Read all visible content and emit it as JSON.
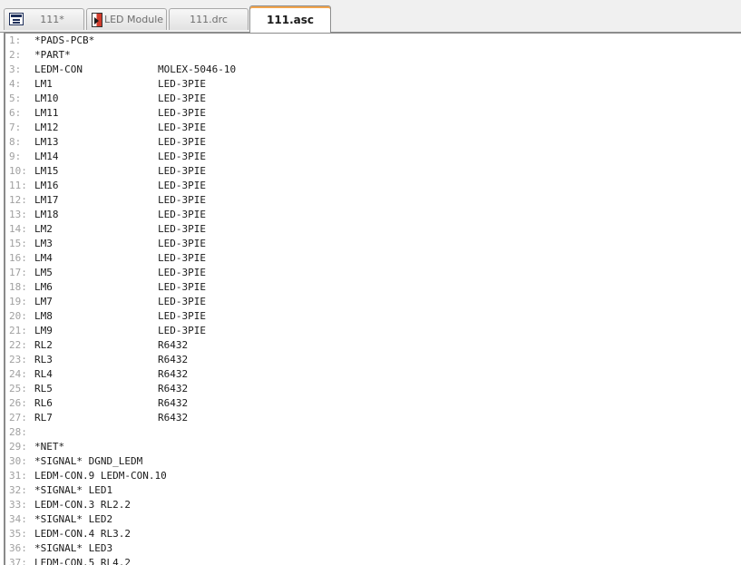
{
  "tabs": [
    {
      "label": "111*",
      "icon": "layout-icon",
      "active": false
    },
    {
      "label": "LED Module",
      "icon": "schematic-icon",
      "active": false
    },
    {
      "label": "111.drc",
      "icon": "",
      "active": false
    },
    {
      "label": "111.asc",
      "icon": "",
      "active": true
    }
  ],
  "lines": [
    {
      "n": "1:",
      "a": "*PADS-PCB*",
      "b": ""
    },
    {
      "n": "2:",
      "a": "*PART*",
      "b": ""
    },
    {
      "n": "3:",
      "a": "LEDM-CON",
      "b": "MOLEX-5046-10"
    },
    {
      "n": "4:",
      "a": "LM1",
      "b": "LED-3PIE"
    },
    {
      "n": "5:",
      "a": "LM10",
      "b": "LED-3PIE"
    },
    {
      "n": "6:",
      "a": "LM11",
      "b": "LED-3PIE"
    },
    {
      "n": "7:",
      "a": "LM12",
      "b": "LED-3PIE"
    },
    {
      "n": "8:",
      "a": "LM13",
      "b": "LED-3PIE"
    },
    {
      "n": "9:",
      "a": "LM14",
      "b": "LED-3PIE"
    },
    {
      "n": "10:",
      "a": "LM15",
      "b": "LED-3PIE"
    },
    {
      "n": "11:",
      "a": "LM16",
      "b": "LED-3PIE"
    },
    {
      "n": "12:",
      "a": "LM17",
      "b": "LED-3PIE"
    },
    {
      "n": "13:",
      "a": "LM18",
      "b": "LED-3PIE"
    },
    {
      "n": "14:",
      "a": "LM2",
      "b": "LED-3PIE"
    },
    {
      "n": "15:",
      "a": "LM3",
      "b": "LED-3PIE"
    },
    {
      "n": "16:",
      "a": "LM4",
      "b": "LED-3PIE"
    },
    {
      "n": "17:",
      "a": "LM5",
      "b": "LED-3PIE"
    },
    {
      "n": "18:",
      "a": "LM6",
      "b": "LED-3PIE"
    },
    {
      "n": "19:",
      "a": "LM7",
      "b": "LED-3PIE"
    },
    {
      "n": "20:",
      "a": "LM8",
      "b": "LED-3PIE"
    },
    {
      "n": "21:",
      "a": "LM9",
      "b": "LED-3PIE"
    },
    {
      "n": "22:",
      "a": "RL2",
      "b": "R6432"
    },
    {
      "n": "23:",
      "a": "RL3",
      "b": "R6432"
    },
    {
      "n": "24:",
      "a": "RL4",
      "b": "R6432"
    },
    {
      "n": "25:",
      "a": "RL5",
      "b": "R6432"
    },
    {
      "n": "26:",
      "a": "RL6",
      "b": "R6432"
    },
    {
      "n": "27:",
      "a": "RL7",
      "b": "R6432"
    },
    {
      "n": "28:",
      "a": "",
      "b": ""
    },
    {
      "n": "29:",
      "a": "*NET*",
      "b": ""
    },
    {
      "n": "30:",
      "a": "*SIGNAL* DGND_LEDM",
      "b": ""
    },
    {
      "n": "31:",
      "a": "LEDM-CON.9 LEDM-CON.10",
      "b": ""
    },
    {
      "n": "32:",
      "a": "*SIGNAL* LED1",
      "b": ""
    },
    {
      "n": "33:",
      "a": "LEDM-CON.3 RL2.2",
      "b": ""
    },
    {
      "n": "34:",
      "a": "*SIGNAL* LED2",
      "b": ""
    },
    {
      "n": "35:",
      "a": "LEDM-CON.4 RL3.2",
      "b": ""
    },
    {
      "n": "36:",
      "a": "*SIGNAL* LED3",
      "b": ""
    },
    {
      "n": "37:",
      "a": "LEDM-CON.5 RL4.2",
      "b": ""
    }
  ]
}
